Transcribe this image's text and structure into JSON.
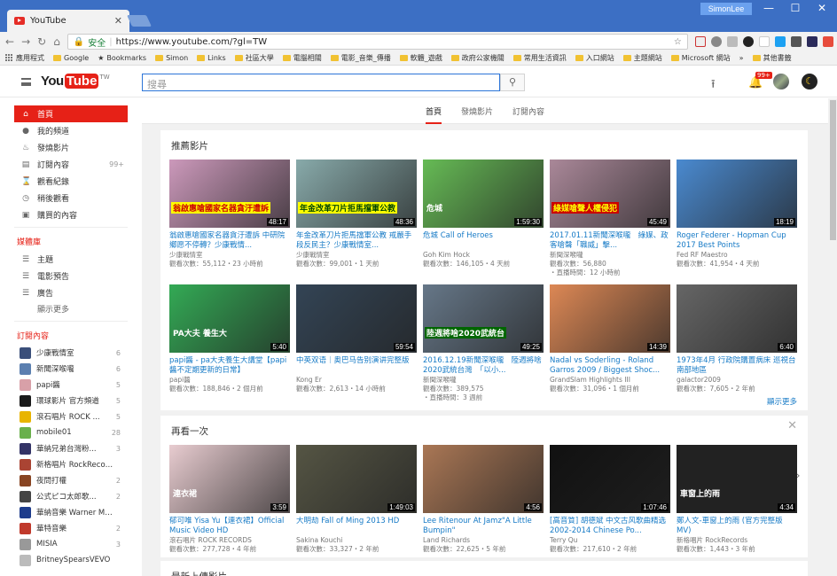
{
  "browser": {
    "tab_title": "YouTube",
    "user": "SimonLee",
    "secure_label": "安全",
    "url": "https://www.youtube.com/?gl=TW"
  },
  "bookmarks": [
    "應用程式",
    "Google",
    "Bookmarks",
    "Simon",
    "Links",
    "社區大學",
    "電腦相關",
    "電影_音樂_傳播",
    "軟體_遊戲",
    "政府公家機關",
    "常用生活資訊",
    "入口網站",
    "主題網站",
    "Microsoft 網站",
    "其他書籤"
  ],
  "header": {
    "logo_you": "You",
    "logo_tube": "Tube",
    "logo_region": "TW",
    "search_placeholder": "搜尋",
    "notif_badge": "99+"
  },
  "sidebar": {
    "main": [
      {
        "label": "首頁",
        "icon": "home-icon",
        "glyph": "⌂"
      },
      {
        "label": "我的頻道",
        "icon": "person-icon",
        "glyph": "●"
      },
      {
        "label": "發燒影片",
        "icon": "flame-icon",
        "glyph": "♨"
      },
      {
        "label": "訂閱內容",
        "icon": "subscriptions-icon",
        "glyph": "▤",
        "count": "99+"
      },
      {
        "label": "觀看紀錄",
        "icon": "history-icon",
        "glyph": "⌛"
      },
      {
        "label": "稍後觀看",
        "icon": "clock-icon",
        "glyph": "◷"
      },
      {
        "label": "購買的內容",
        "icon": "purchase-icon",
        "glyph": "▣"
      }
    ],
    "library_head": "媒體庫",
    "library": [
      {
        "label": "主題",
        "icon": "list-icon"
      },
      {
        "label": "電影預告",
        "icon": "list-icon"
      },
      {
        "label": "廣告",
        "icon": "list-icon"
      }
    ],
    "show_more": "顯示更多",
    "subs_head": "訂閱內容",
    "subs": [
      {
        "name": "少康戰情室",
        "count": "6",
        "color": "#3a4f7a"
      },
      {
        "name": "新聞深喉嚨",
        "count": "6",
        "color": "#5b7fb0"
      },
      {
        "name": "papi醬",
        "count": "5",
        "color": "#d8a0a8"
      },
      {
        "name": "環球影片 官方頻道",
        "count": "5",
        "color": "#1a1a1a"
      },
      {
        "name": "滾石唱片 ROCK ...",
        "count": "5",
        "color": "#e8b400"
      },
      {
        "name": "mobile01",
        "count": "28",
        "color": "#6ab04c"
      },
      {
        "name": "華納兄弟台灣粉...",
        "count": "3",
        "color": "#333366"
      },
      {
        "name": "新格唱片 RockRecords",
        "count": "",
        "color": "#a43"
      },
      {
        "name": "夜問打權",
        "count": "2",
        "color": "#884422"
      },
      {
        "name": "公式ピコ太郎歌...",
        "count": "2",
        "color": "#444"
      },
      {
        "name": "華納音樂 Warner Musi...",
        "count": "",
        "color": "#1d3c8c"
      },
      {
        "name": "華特音樂",
        "count": "2",
        "color": "#c0392b"
      },
      {
        "name": "MISIA",
        "count": "3",
        "color": "#999"
      },
      {
        "name": "BritneySpearsVEVO",
        "count": "",
        "color": "#bbb"
      }
    ]
  },
  "topnav": [
    "首頁",
    "發燒影片",
    "訂閱內容"
  ],
  "shelves": {
    "recommended": {
      "title": "推薦影片",
      "show_more": "顯示更多",
      "row1": [
        {
          "title": "翁啟惠嗆國家名器貪汙遭訴 中研院鄉愿不停轉？少康戰情...",
          "channel": "少康戰情室",
          "meta": "觀看次數：55,112・23 小時前",
          "extra": "",
          "duration": "48:17",
          "bg": "#c9b",
          "overlay": "翁啟惠嗆國家名器貪汙遭訴",
          "ovcolor": "#c00",
          "ovbg": "#ff0"
        },
        {
          "title": "年金改革刀片拒馬擋軍公教 戒嚴手段反民主？少康戰情室...",
          "channel": "少康戰情室",
          "meta": "觀看次數：99,001・1 天前",
          "extra": "",
          "duration": "48:36",
          "bg": "#8aa",
          "overlay": "年金改革刀片拒馬擋軍公教",
          "ovcolor": "#040",
          "ovbg": "#ff0"
        },
        {
          "title": "危城 Call of Heroes",
          "channel": "Goh Kim Hock",
          "meta": "觀看次數：146,105・4 天前",
          "extra": "",
          "duration": "1:59:30",
          "bg": "#6b5",
          "overlay": "危城",
          "ovcolor": "#fff",
          "ovbg": "transparent"
        },
        {
          "title": "2017.01.11新聞深喉嚨　綠媒、政客嗆聲「職威」擊...",
          "channel": "新聞深喉嚨",
          "meta": "觀看次數：56,880",
          "extra": "・直播時間：12 小時前",
          "duration": "45:49",
          "bg": "#a89",
          "overlay": "綠媒嗆聲人權侵犯",
          "ovcolor": "#ff0",
          "ovbg": "#c00"
        },
        {
          "title": "Roger Federer - Hopman Cup 2017 Best Points",
          "channel": "Fed RF Maestro",
          "meta": "觀看次數：41,954・4 天前",
          "extra": "",
          "duration": "18:19",
          "bg": "#4a8ad0",
          "overlay": "",
          "ovcolor": "#fff",
          "ovbg": "transparent"
        }
      ],
      "row2": [
        {
          "title": "papi醬 - pa大夫養生大講堂【papi醬不定期更新的日常】",
          "channel": "papi醬",
          "meta": "觀看次數：188,846・2 個月前",
          "extra": "",
          "duration": "5:40",
          "bg": "#3a5",
          "overlay": "PA大夫 養生大",
          "ovcolor": "#fff",
          "ovbg": "transparent"
        },
        {
          "title": "中英双语｜奥巴马告别演讲完整版",
          "channel": "Kong Er",
          "meta": "觀看次數：2,613・14 小時前",
          "extra": "",
          "duration": "59:54",
          "bg": "#345",
          "overlay": "",
          "ovcolor": "#fff",
          "ovbg": "transparent"
        },
        {
          "title": "2016.12.19新聞深喉嚨　陸週將啥2020武統台灣　「以小...",
          "channel": "新聞深喉嚨",
          "meta": "觀看次數：389,575",
          "extra": "・直播時間：3 週前",
          "duration": "49:25",
          "bg": "#678",
          "overlay": "陸週將啥2020武統台",
          "ovcolor": "#fff",
          "ovbg": "#060"
        },
        {
          "title": "Nadal vs Soderling - Roland Garros 2009 / Biggest Shoc...",
          "channel": "GrandSlam Highlights III",
          "meta": "觀看次數：31,096・1 個月前",
          "extra": "",
          "duration": "14:39",
          "bg": "#d85",
          "overlay": "",
          "ovcolor": "#fff",
          "ovbg": "transparent"
        },
        {
          "title": "1973年4月 行政院購置病床 巡視台南部地區",
          "channel": "galactor2009",
          "meta": "觀看次數：7,605・2 年前",
          "extra": "",
          "duration": "6:40",
          "bg": "#666",
          "overlay": "",
          "ovcolor": "#fff",
          "ovbg": "transparent"
        }
      ]
    },
    "watch_again": {
      "title": "再看一次",
      "row": [
        {
          "title": "郁可唯 Yisa Yu【連衣裙】Official Music Video HD",
          "channel": "滾石唱片 ROCK RECORDS",
          "meta": "觀看次數：277,728・4 年前",
          "extra": "",
          "duration": "3:59",
          "bg": "#e8ccd0",
          "overlay": "連衣裙",
          "ovcolor": "#fff",
          "ovbg": "transparent"
        },
        {
          "title": "大明劫 Fall of Ming 2013 HD",
          "channel": "Sakina Kouchi",
          "meta": "觀看次數：33,327・2 年前",
          "extra": "",
          "duration": "1:49:03",
          "bg": "#554",
          "overlay": "",
          "ovcolor": "#fff",
          "ovbg": "transparent"
        },
        {
          "title": "Lee Ritenour At Jamz\"A Little Bumpin\"",
          "channel": "Land Richards",
          "meta": "觀看次數：22,625・5 年前",
          "extra": "",
          "duration": "4:56",
          "bg": "#a75",
          "overlay": "",
          "ovcolor": "#fff",
          "ovbg": "transparent"
        },
        {
          "title": "[高音質] 胡德斌 中文古风歌曲精选 2002-2014 Chinese Po...",
          "channel": "Terry Qu",
          "meta": "觀看次數：217,610・2 年前",
          "extra": "",
          "duration": "1:07:46",
          "bg": "#111",
          "overlay": "",
          "ovcolor": "#fff",
          "ovbg": "transparent"
        },
        {
          "title": "鄭人文-車窗上的雨 (官方完整版MV)",
          "channel": "新格唱片 RockRecords",
          "meta": "觀看次數：1,443・3 年前",
          "extra": "",
          "duration": "4:34",
          "bg": "#222",
          "overlay": "車窗上的雨",
          "ovcolor": "#fff",
          "ovbg": "transparent"
        }
      ]
    },
    "next_title": "最新上傳影片"
  }
}
